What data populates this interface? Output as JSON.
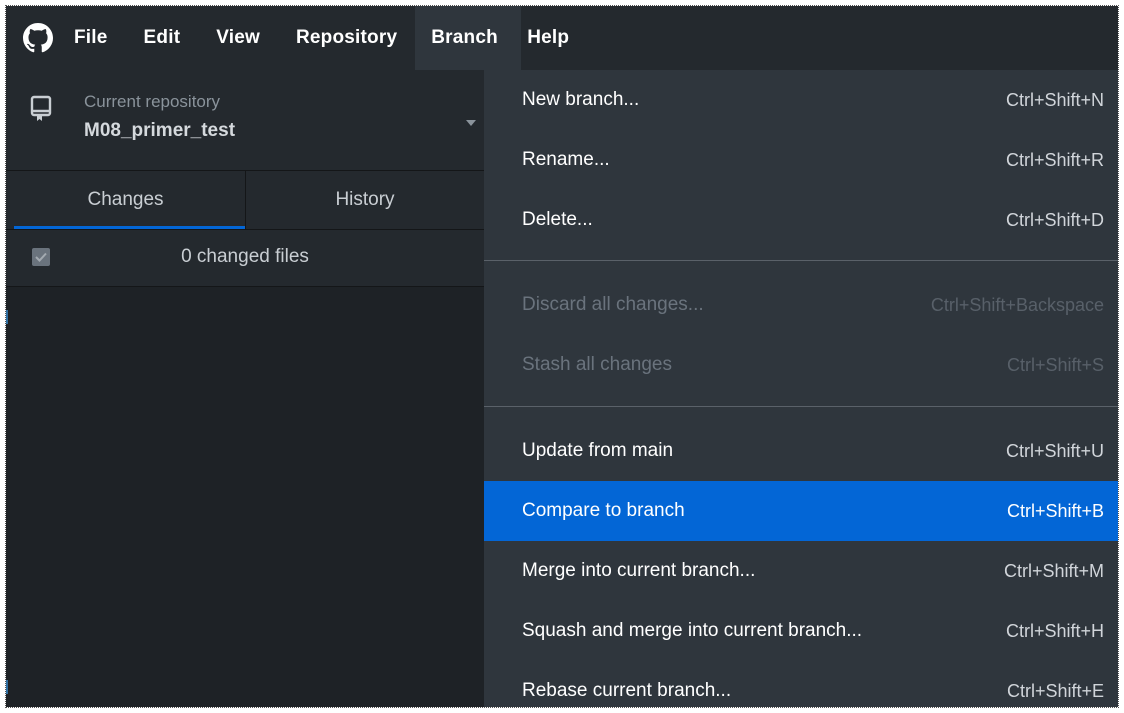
{
  "menubar": {
    "items": [
      {
        "label": "File"
      },
      {
        "label": "Edit"
      },
      {
        "label": "View"
      },
      {
        "label": "Repository"
      },
      {
        "label": "Branch"
      },
      {
        "label": "Help"
      }
    ],
    "active": "Branch"
  },
  "repository": {
    "label": "Current repository",
    "name": "M08_primer_test"
  },
  "tabs": [
    {
      "label": "Changes",
      "selected": true
    },
    {
      "label": "History",
      "selected": false
    }
  ],
  "changes": {
    "summary": "0 changed files",
    "all_checked": true
  },
  "branch_menu": {
    "items": [
      {
        "label": "New branch...",
        "shortcut": "Ctrl+Shift+N",
        "enabled": true
      },
      {
        "label": "Rename...",
        "shortcut": "Ctrl+Shift+R",
        "enabled": true
      },
      {
        "label": "Delete...",
        "shortcut": "Ctrl+Shift+D",
        "enabled": true
      },
      {
        "label": "Discard all changes...",
        "shortcut": "Ctrl+Shift+Backspace",
        "enabled": false
      },
      {
        "label": "Stash all changes",
        "shortcut": "Ctrl+Shift+S",
        "enabled": false
      },
      {
        "label": "Update from main",
        "shortcut": "Ctrl+Shift+U",
        "enabled": true
      },
      {
        "label": "Compare to branch",
        "shortcut": "Ctrl+Shift+B",
        "enabled": true,
        "highlighted": true
      },
      {
        "label": "Merge into current branch...",
        "shortcut": "Ctrl+Shift+M",
        "enabled": true
      },
      {
        "label": "Squash and merge into current branch...",
        "shortcut": "Ctrl+Shift+H",
        "enabled": true
      },
      {
        "label": "Rebase current branch...",
        "shortcut": "Ctrl+Shift+E",
        "enabled": true
      }
    ]
  },
  "icons": {
    "app": "github-logo-icon",
    "repo": "repository-icon",
    "caret": "chevron-down-icon",
    "checkbox": "checkmark-icon"
  },
  "colors": {
    "menubar_bg": "#24292e",
    "menu_bg": "#2f363d",
    "highlight": "#0366d6",
    "tab_indicator": "#0366d6"
  }
}
